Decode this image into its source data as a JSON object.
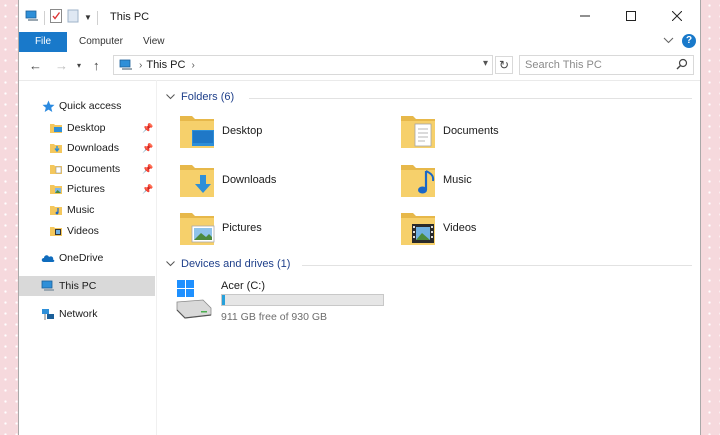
{
  "window": {
    "title": "This PC"
  },
  "ribbon": {
    "tabs": [
      "File",
      "Computer",
      "View"
    ]
  },
  "navbar": {
    "address_path": "This PC",
    "search_placeholder": "Search This PC"
  },
  "sidebar": {
    "items": [
      {
        "label": "Quick access",
        "icon": "star-icon",
        "pinned": false
      },
      {
        "label": "Desktop",
        "icon": "desktop-folder-icon",
        "pinned": true
      },
      {
        "label": "Downloads",
        "icon": "downloads-folder-icon",
        "pinned": true
      },
      {
        "label": "Documents",
        "icon": "documents-folder-icon",
        "pinned": true
      },
      {
        "label": "Pictures",
        "icon": "pictures-folder-icon",
        "pinned": true
      },
      {
        "label": "Music",
        "icon": "music-folder-icon",
        "pinned": false
      },
      {
        "label": "Videos",
        "icon": "videos-folder-icon",
        "pinned": false
      },
      {
        "label": "OneDrive",
        "icon": "cloud-icon",
        "pinned": false
      },
      {
        "label": "This PC",
        "icon": "computer-icon",
        "pinned": false,
        "selected": true
      },
      {
        "label": "Network",
        "icon": "network-icon",
        "pinned": false
      }
    ]
  },
  "content": {
    "folders_header": "Folders (6)",
    "folders": [
      "Desktop",
      "Documents",
      "Downloads",
      "Music",
      "Pictures",
      "Videos"
    ],
    "drives_header": "Devices and drives (1)",
    "drive": {
      "label": "Acer (C:)",
      "used_fraction": 0.02,
      "free_text": "911 GB free of 930 GB"
    }
  },
  "colors": {
    "accent": "#1979ca",
    "folder": "#f4c75c",
    "drive_bar": "#26a0da",
    "background": "#f6d9dd"
  }
}
